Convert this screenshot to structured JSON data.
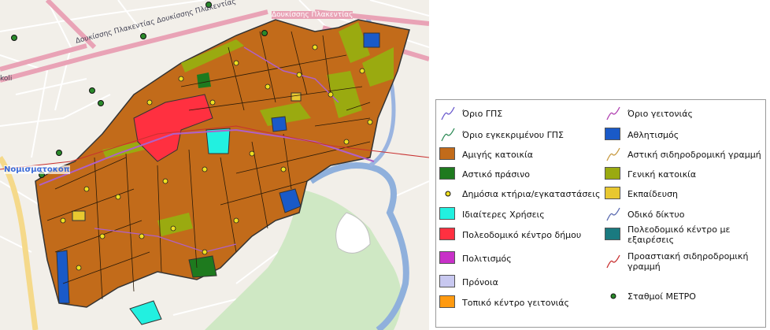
{
  "map": {
    "street_labels": [
      {
        "text": "Δουκίσσης Πλακεντίας",
        "kind": "street-top"
      },
      {
        "text": "Δουκίσσης Πλακεντίας Δουκίσσης Πλακεντίας",
        "kind": "street-diagonal"
      },
      {
        "text": "Νομισματοκοπ",
        "kind": "station"
      },
      {
        "text": "koli",
        "kind": "edge"
      }
    ]
  },
  "legend": {
    "items": [
      {
        "label": "Όριο ΓΠΣ",
        "symbol": "line",
        "color": "#6a5acd"
      },
      {
        "label": "Όριο εγκεκριμένου ΓΠΣ",
        "symbol": "line",
        "color": "#2e8b57"
      },
      {
        "label": "Αμιγής κατοικία",
        "symbol": "fill",
        "color": "#c26b1a"
      },
      {
        "label": "Αστικό πράσινο",
        "symbol": "fill",
        "color": "#1e7a1e"
      },
      {
        "label": "Δημόσια κτήρια/εγκαταστάσεις",
        "symbol": "dot",
        "color": "#f0e020"
      },
      {
        "label": "Ιδιαίτερες Χρήσεις",
        "symbol": "fill",
        "color": "#22f0e0"
      },
      {
        "label": "Πολεοδομικό κέντρο δήμου",
        "symbol": "fill",
        "color": "#ff3040"
      },
      {
        "label": "Πολιτισμός",
        "symbol": "fill",
        "color": "#c830c8"
      },
      {
        "label": "Πρόνοια",
        "symbol": "fill",
        "color": "#c8c8f0"
      },
      {
        "label": "Τοπικό κέντρο γειτονιάς",
        "symbol": "fill",
        "color": "#ff9a10"
      },
      {
        "label": "Όριο γειτονιάς",
        "symbol": "line",
        "color": "#b040b0"
      },
      {
        "label": "Αθλητισμός",
        "symbol": "fill",
        "color": "#1a5ac8"
      },
      {
        "label": "Αστική σιδηροδρομική γραμμή",
        "symbol": "line",
        "color": "#c89a40"
      },
      {
        "label": "Γενική κατοικία",
        "symbol": "fill",
        "color": "#9aaa10"
      },
      {
        "label": "Εκπαίδευση",
        "symbol": "fill",
        "color": "#e8c830"
      },
      {
        "label": "Οδικό δίκτυο",
        "symbol": "line",
        "color": "#5a6ab0"
      },
      {
        "label": "Πολεοδομικό κέντρο με εξαιρέσεις",
        "symbol": "fill",
        "color": "#1a7a80"
      },
      {
        "label": "Προαστιακή σιδηροδρομική γραμμή",
        "symbol": "line",
        "color": "#c83030"
      },
      {
        "label": "Σταθμοί ΜΕΤΡΟ",
        "symbol": "metro",
        "color": "#2a8a2a"
      }
    ]
  }
}
